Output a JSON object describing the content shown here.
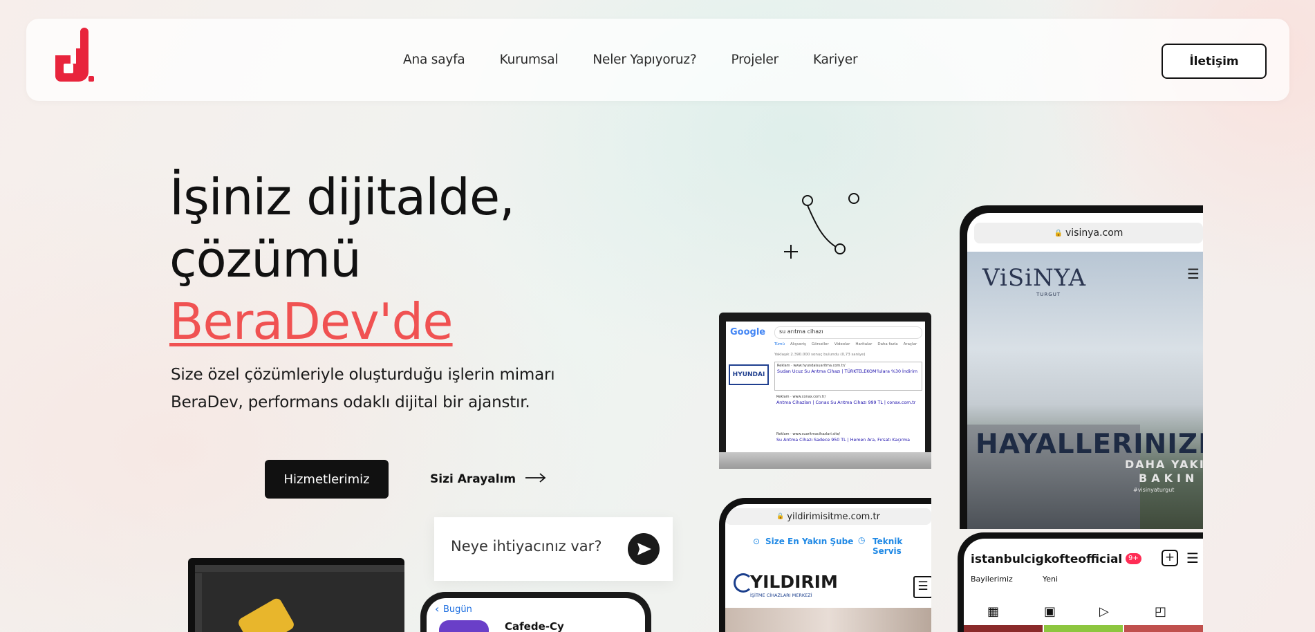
{
  "nav": {
    "links": [
      "Ana sayfa",
      "Kurumsal",
      "Neler Yapıyoruz?",
      "Projeler",
      "Kariyer"
    ],
    "contact_label": "İletişim"
  },
  "hero": {
    "title_line1": "İşiniz dijitalde,",
    "title_line2": "çözümü",
    "title_accent": "BeraDev'de",
    "description": "Size özel çözümleriyle oluşturduğu işlerin mimarı BeraDev, performans odaklı dijital bir ajanstır.",
    "services_button": "Hizmetlerimiz",
    "call_button": "Sizi Arayalım"
  },
  "chat": {
    "placeholder": "Neye ihtiyacınız var?"
  },
  "colors": {
    "brand": "#e8243c",
    "accent": "#f05252",
    "dark": "#111111"
  },
  "showcase": {
    "google": {
      "logo": "Google",
      "query": "su arıtma cihazı",
      "tabs": [
        "Tümü",
        "Alışveriş",
        "Görseller",
        "Videolar",
        "Haritalar",
        "Daha fazla",
        "Araçlar"
      ],
      "result_count": "Yaklaşık 2.390.000 sonuç bulundu (0,73 saniye)",
      "brand_box": "HYUNDAI",
      "ads": [
        {
          "url": "Reklam · www.hyundaisuaritma.com.tr/",
          "title": "Sudan Ucuz Su Arıtma Cihazı | TÜRKTELEKOM'lulara %30 İndirim"
        },
        {
          "url": "Reklam · www.conax.com.tr/",
          "title": "Arıtma Cihazları | Conax Su Arıtma Cihazı 999 TL | conax.com.tr"
        },
        {
          "url": "Reklam · www.suaritmacihazlari.site/",
          "title": "Su Arıtma Cihazı Sadece 950 TL | Hemen Ara, Fırsatı Kaçırma"
        }
      ]
    },
    "visinya": {
      "url": "visinya.com",
      "brand": "ViSiNYA",
      "brand_sub": "TURGUT",
      "headline": "HAYALLERINIZE",
      "sub1": "DAHA YAKIN",
      "sub2": "BAKIN",
      "tag": "#visinyaturgut"
    },
    "yildirim": {
      "url": "yildirimisitme.com.tr",
      "link1": "Size En Yakın Şube",
      "link2": "Teknik Servis",
      "brand": "YILDIRIM",
      "brand_sub": "İŞİTME CİHAZLARI MERKEZİ"
    },
    "insta": {
      "username": "istanbulcigkofteofficial",
      "badge": "9+",
      "tab1": "Bayilerimiz",
      "tab2": "Yeni"
    },
    "cafe": {
      "back": "Bugün",
      "title": "Cafede-Cy"
    }
  }
}
